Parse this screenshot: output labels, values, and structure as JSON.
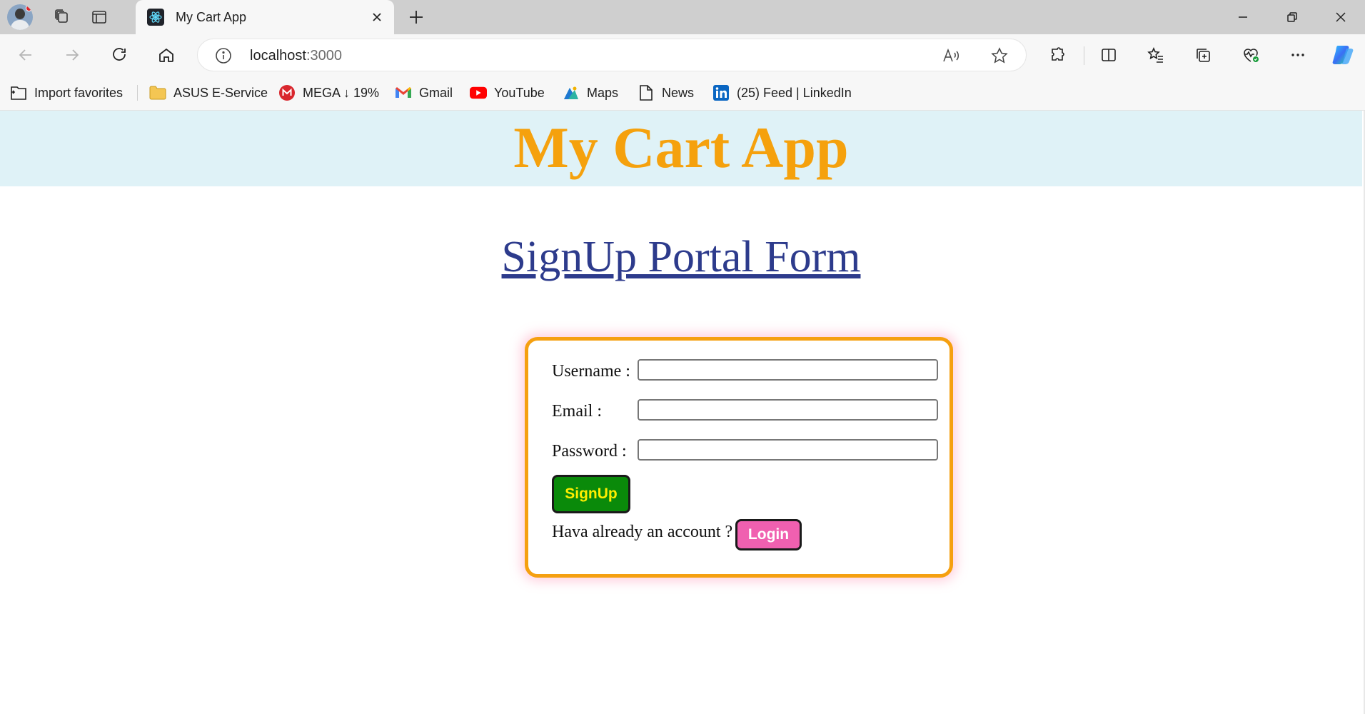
{
  "browser": {
    "tab_title": "My Cart App",
    "url_host": "localhost",
    "url_port": ":3000",
    "favorites": [
      {
        "label": "Import favorites",
        "icon": "import-icon"
      },
      {
        "label": "ASUS E-Service",
        "icon": "folder-icon"
      },
      {
        "label": "MEGA ↓ 19%",
        "icon": "mega-icon"
      },
      {
        "label": "Gmail",
        "icon": "gmail-icon"
      },
      {
        "label": "YouTube",
        "icon": "youtube-icon"
      },
      {
        "label": "Maps",
        "icon": "maps-icon"
      },
      {
        "label": "News",
        "icon": "document-icon"
      },
      {
        "label": "(25) Feed | LinkedIn",
        "icon": "linkedin-icon"
      }
    ]
  },
  "app": {
    "title": "My Cart App",
    "portal_title": "SignUp Portal Form",
    "form": {
      "username_label": "Username :",
      "email_label": "Email :",
      "password_label": "Password :",
      "username_value": "",
      "email_value": "",
      "password_value": "",
      "signup_label": "SignUp",
      "have_account_text": "Hava already an account ?",
      "login_label": "Login"
    }
  },
  "colors": {
    "header_bg": "#dff2f7",
    "title": "#f5a10d",
    "portal_title": "#2d3b8c",
    "card_border": "#f5a010",
    "signup_bg": "#0a8a0a",
    "signup_text": "#ffee00",
    "login_bg": "#f060b0"
  }
}
